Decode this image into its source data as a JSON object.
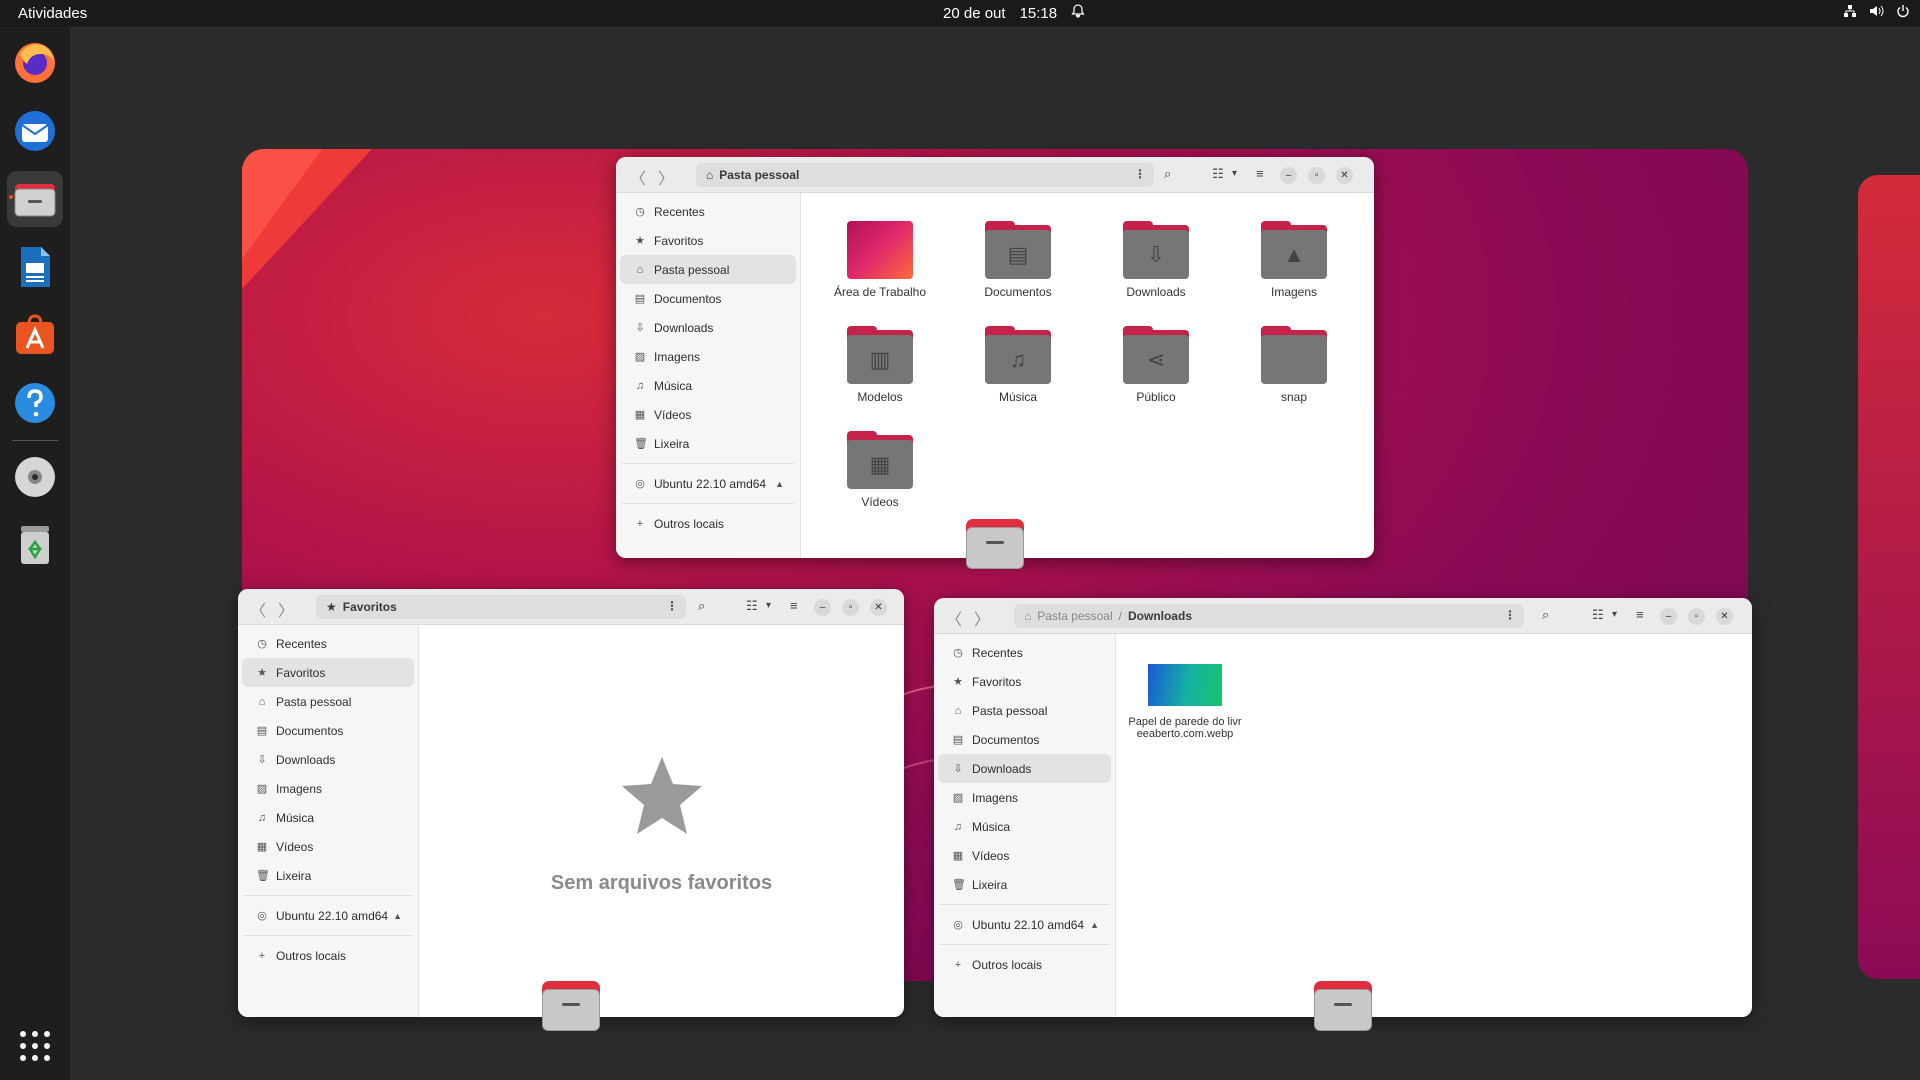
{
  "topbar": {
    "activities": "Atividades",
    "date": "20 de out",
    "time": "15:18",
    "icons": [
      "bell-icon",
      "network-icon",
      "volume-icon",
      "power-icon"
    ]
  },
  "dock": {
    "apps": [
      "firefox",
      "thunderbird",
      "files",
      "libreoffice-writer",
      "app-center",
      "help",
      "disc",
      "trash"
    ],
    "show_apps_icon": "grid-icon"
  },
  "window_home": {
    "path": "Pasta pessoal",
    "sidebar": [
      "Recentes",
      "Favoritos",
      "Pasta pessoal",
      "Documentos",
      "Downloads",
      "Imagens",
      "Música",
      "Vídeos",
      "Lixeira"
    ],
    "volume": "Ubuntu 22.10 amd64",
    "other": "Outros locais",
    "files": [
      "Área de Trabalho",
      "Documentos",
      "Downloads",
      "Imagens",
      "Modelos",
      "Música",
      "Público",
      "snap",
      "Vídeos"
    ]
  },
  "window_fav": {
    "path": "Favoritos",
    "sidebar": [
      "Recentes",
      "Favoritos",
      "Pasta pessoal",
      "Documentos",
      "Downloads",
      "Imagens",
      "Música",
      "Vídeos",
      "Lixeira"
    ],
    "volume": "Ubuntu 22.10 amd64",
    "other": "Outros locais",
    "empty": "Sem arquivos favoritos"
  },
  "window_dl": {
    "path_parent": "Pasta pessoal",
    "path_current": "Downloads",
    "sidebar": [
      "Recentes",
      "Favoritos",
      "Pasta pessoal",
      "Documentos",
      "Downloads",
      "Imagens",
      "Música",
      "Vídeos",
      "Lixeira"
    ],
    "volume": "Ubuntu 22.10 amd64",
    "other": "Outros locais",
    "file": "Papel de parede do livreeaberto.com.webp"
  }
}
